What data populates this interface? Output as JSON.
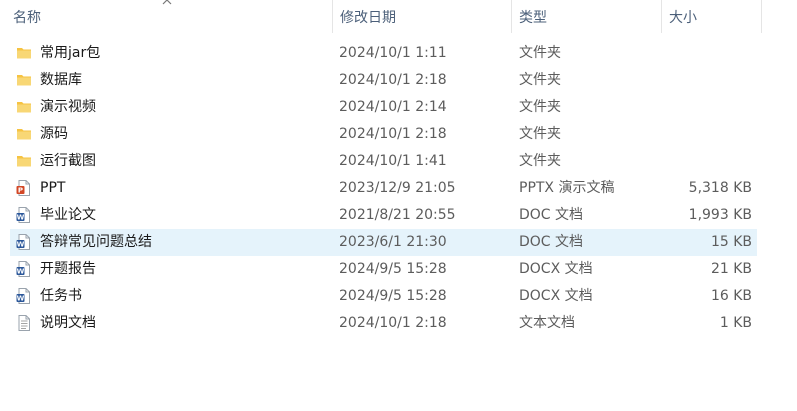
{
  "columns": {
    "name": "名称",
    "date": "修改日期",
    "type": "类型",
    "size": "大小"
  },
  "sort": {
    "column": "name",
    "direction": "ascending",
    "icon": "sort-up-arrow"
  },
  "colors": {
    "folder": "#f6c342",
    "pptx": "#d24726",
    "doc": "#2b579a",
    "text_file": "#8a8a8a",
    "selected_row": "#e5f3fb"
  },
  "files": [
    {
      "name": "常用jar包",
      "date": "2024/10/1 1:11",
      "type": "文件夹",
      "size": "",
      "icon": "folder-icon"
    },
    {
      "name": "数据库",
      "date": "2024/10/1 2:18",
      "type": "文件夹",
      "size": "",
      "icon": "folder-icon"
    },
    {
      "name": "演示视频",
      "date": "2024/10/1 2:14",
      "type": "文件夹",
      "size": "",
      "icon": "folder-icon"
    },
    {
      "name": "源码",
      "date": "2024/10/1 2:18",
      "type": "文件夹",
      "size": "",
      "icon": "folder-icon"
    },
    {
      "name": "运行截图",
      "date": "2024/10/1 1:41",
      "type": "文件夹",
      "size": "",
      "icon": "folder-icon"
    },
    {
      "name": "PPT",
      "date": "2023/12/9 21:05",
      "type": "PPTX 演示文稿",
      "size": "5,318 KB",
      "icon": "pptx-file-icon"
    },
    {
      "name": "毕业论文",
      "date": "2021/8/21 20:55",
      "type": "DOC 文档",
      "size": "1,993 KB",
      "icon": "doc-file-icon"
    },
    {
      "name": "答辩常见问题总结",
      "date": "2023/6/1 21:30",
      "type": "DOC 文档",
      "size": "15 KB",
      "icon": "doc-file-icon",
      "selected": true
    },
    {
      "name": "开题报告",
      "date": "2024/9/5 15:28",
      "type": "DOCX 文档",
      "size": "21 KB",
      "icon": "docx-file-icon"
    },
    {
      "name": "任务书",
      "date": "2024/9/5 15:28",
      "type": "DOCX 文档",
      "size": "16 KB",
      "icon": "docx-file-icon"
    },
    {
      "name": "说明文档",
      "date": "2024/10/1 2:18",
      "type": "文本文档",
      "size": "1 KB",
      "icon": "text-file-icon"
    }
  ]
}
